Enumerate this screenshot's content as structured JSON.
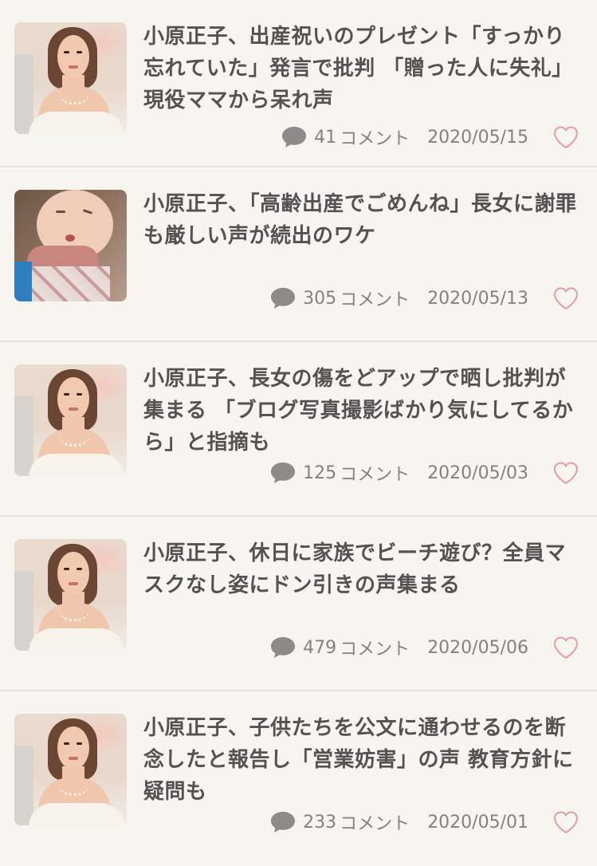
{
  "articles": [
    {
      "title": "小原正子、出産祝いのプレゼント「すっかり忘れていた」発言で批判 「贈った人に失礼」現役ママから呆れ声",
      "comment_count": "41",
      "comment_label": "コメント",
      "date": "2020/05/15",
      "thumbnail": "woman-portrait"
    },
    {
      "title": "小原正子、「高齢出産でごめんね」長女に謝罪も厳しい声が続出のワケ",
      "comment_count": "305",
      "comment_label": "コメント",
      "date": "2020/05/13",
      "thumbnail": "baby-portrait"
    },
    {
      "title": "小原正子、長女の傷をどアップで晒し批判が集まる 「ブログ写真撮影ばかり気にしてるから」と指摘も",
      "comment_count": "125",
      "comment_label": "コメント",
      "date": "2020/05/03",
      "thumbnail": "woman-portrait"
    },
    {
      "title": "小原正子、休日に家族でビーチ遊び？全員マスクなし姿にドン引きの声集まる",
      "comment_count": "479",
      "comment_label": "コメント",
      "date": "2020/05/06",
      "thumbnail": "woman-portrait"
    },
    {
      "title": "小原正子、子供たちを公文に通わせるのを断念したと報告し「営業妨害」の声 教育方針に疑問も",
      "comment_count": "233",
      "comment_label": "コメント",
      "date": "2020/05/01",
      "thumbnail": "woman-portrait"
    }
  ],
  "icons": {
    "comment": "speech-bubble-icon",
    "like": "heart-outline-icon"
  },
  "colors": {
    "background": "#f7f5f0",
    "title_text": "#555252",
    "meta_text": "#858180",
    "heart": "#e89aa3",
    "divider": "#e6e2da"
  }
}
